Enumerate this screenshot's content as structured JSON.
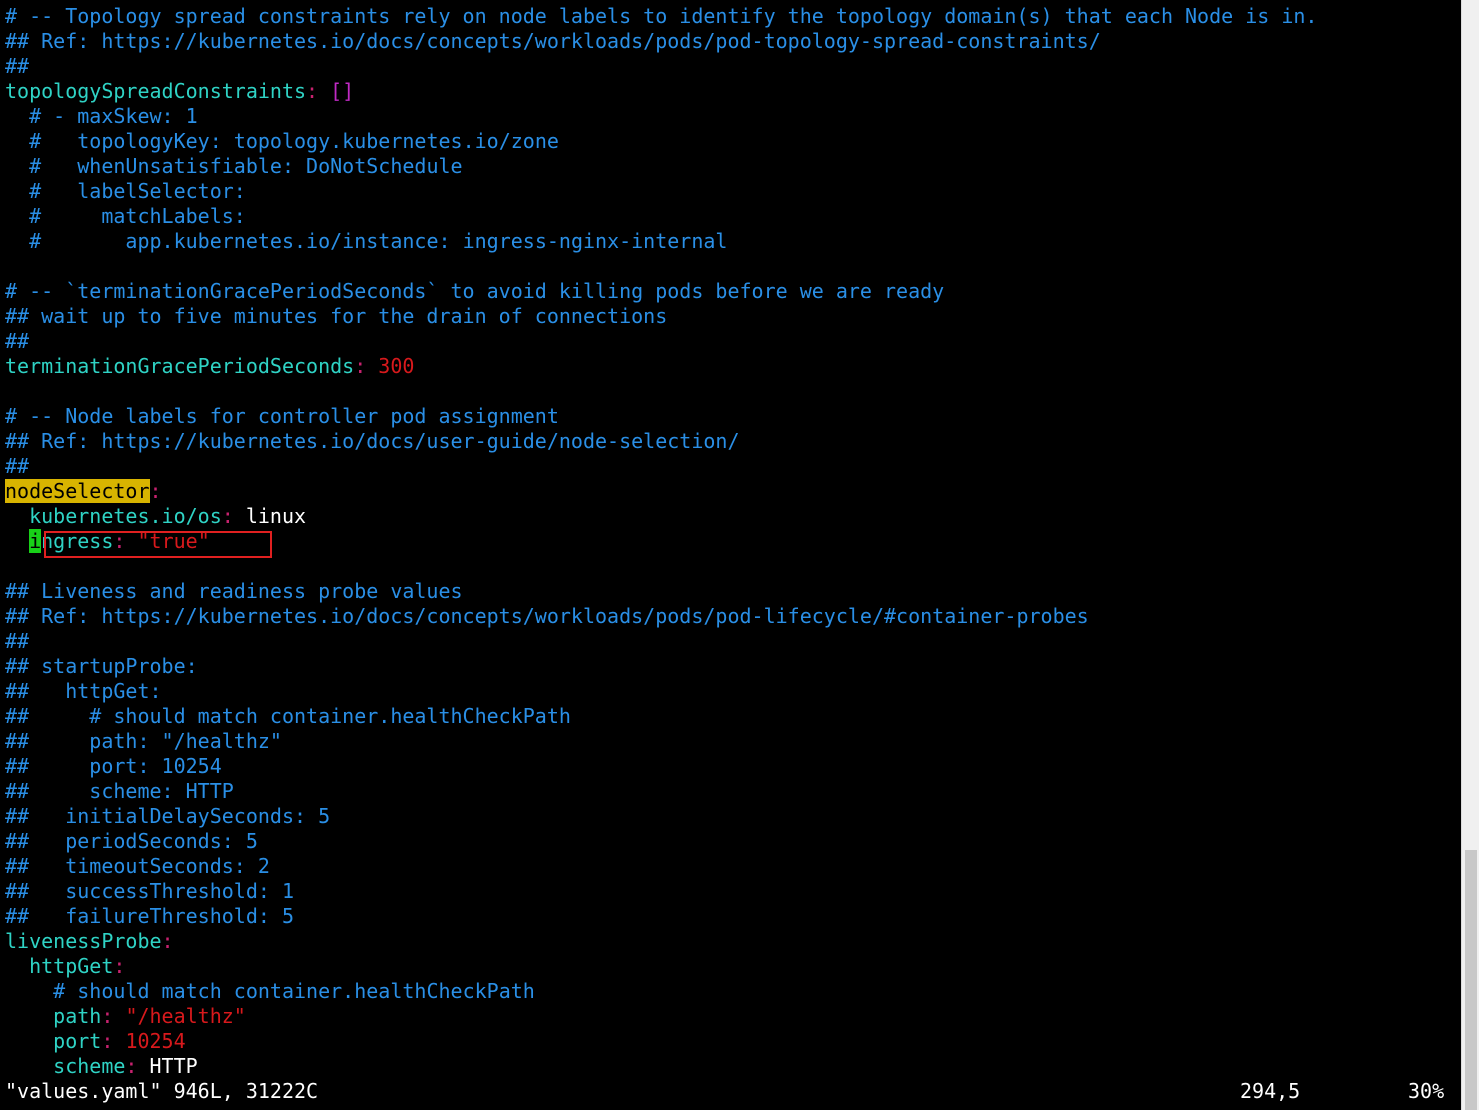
{
  "editor": {
    "lines": [
      [
        {
          "t": "comment",
          "v": "# -- Topology spread constraints rely on node labels to identify the topology domain(s) that each Node is in."
        }
      ],
      [
        {
          "t": "comment",
          "v": "## Ref: https://kubernetes.io/docs/concepts/workloads/pods/pod-topology-spread-constraints/"
        }
      ],
      [
        {
          "t": "comment",
          "v": "##"
        }
      ],
      [
        {
          "t": "key",
          "v": "topologySpreadConstraints"
        },
        {
          "t": "punct",
          "v": ":"
        },
        {
          "t": "plain",
          "v": " "
        },
        {
          "t": "bracket",
          "v": "[]"
        }
      ],
      [
        {
          "t": "plain",
          "v": "  "
        },
        {
          "t": "comment",
          "v": "# - maxSkew: 1"
        }
      ],
      [
        {
          "t": "plain",
          "v": "  "
        },
        {
          "t": "comment",
          "v": "#   topologyKey: topology.kubernetes.io/zone"
        }
      ],
      [
        {
          "t": "plain",
          "v": "  "
        },
        {
          "t": "comment",
          "v": "#   whenUnsatisfiable: DoNotSchedule"
        }
      ],
      [
        {
          "t": "plain",
          "v": "  "
        },
        {
          "t": "comment",
          "v": "#   labelSelector:"
        }
      ],
      [
        {
          "t": "plain",
          "v": "  "
        },
        {
          "t": "comment",
          "v": "#     matchLabels:"
        }
      ],
      [
        {
          "t": "plain",
          "v": "  "
        },
        {
          "t": "comment",
          "v": "#       app.kubernetes.io/instance: ingress-nginx-internal"
        }
      ],
      [],
      [
        {
          "t": "comment",
          "v": "# -- `terminationGracePeriodSeconds` to avoid killing pods before we are ready"
        }
      ],
      [
        {
          "t": "comment",
          "v": "## wait up to five minutes for the drain of connections"
        }
      ],
      [
        {
          "t": "comment",
          "v": "##"
        }
      ],
      [
        {
          "t": "key",
          "v": "terminationGracePeriodSeconds"
        },
        {
          "t": "punct",
          "v": ":"
        },
        {
          "t": "plain",
          "v": " "
        },
        {
          "t": "num",
          "v": "300"
        }
      ],
      [],
      [
        {
          "t": "comment",
          "v": "# -- Node labels for controller pod assignment"
        }
      ],
      [
        {
          "t": "comment",
          "v": "## Ref: https://kubernetes.io/docs/user-guide/node-selection/"
        }
      ],
      [
        {
          "t": "comment",
          "v": "##"
        }
      ],
      [
        {
          "t": "search",
          "v": "nodeSelector"
        },
        {
          "t": "punct",
          "v": ":"
        }
      ],
      [
        {
          "t": "plain",
          "v": "  "
        },
        {
          "t": "key",
          "v": "kubernetes.io/os"
        },
        {
          "t": "punct",
          "v": ":"
        },
        {
          "t": "plain",
          "v": " linux"
        }
      ],
      [
        {
          "t": "plain",
          "v": "  "
        },
        {
          "t": "cursor",
          "v": "i"
        },
        {
          "t": "key",
          "v": "ngress"
        },
        {
          "t": "punct",
          "v": ":"
        },
        {
          "t": "plain",
          "v": " "
        },
        {
          "t": "str",
          "v": "\"true\""
        }
      ],
      [],
      [
        {
          "t": "comment",
          "v": "## Liveness and readiness probe values"
        }
      ],
      [
        {
          "t": "comment",
          "v": "## Ref: https://kubernetes.io/docs/concepts/workloads/pods/pod-lifecycle/#container-probes"
        }
      ],
      [
        {
          "t": "comment",
          "v": "##"
        }
      ],
      [
        {
          "t": "comment",
          "v": "## startupProbe:"
        }
      ],
      [
        {
          "t": "comment",
          "v": "##   httpGet:"
        }
      ],
      [
        {
          "t": "comment",
          "v": "##     # should match container.healthCheckPath"
        }
      ],
      [
        {
          "t": "comment",
          "v": "##     path: \"/healthz\""
        }
      ],
      [
        {
          "t": "comment",
          "v": "##     port: 10254"
        }
      ],
      [
        {
          "t": "comment",
          "v": "##     scheme: HTTP"
        }
      ],
      [
        {
          "t": "comment",
          "v": "##   initialDelaySeconds: 5"
        }
      ],
      [
        {
          "t": "comment",
          "v": "##   periodSeconds: 5"
        }
      ],
      [
        {
          "t": "comment",
          "v": "##   timeoutSeconds: 2"
        }
      ],
      [
        {
          "t": "comment",
          "v": "##   successThreshold: 1"
        }
      ],
      [
        {
          "t": "comment",
          "v": "##   failureThreshold: 5"
        }
      ],
      [
        {
          "t": "key",
          "v": "livenessProbe"
        },
        {
          "t": "punct",
          "v": ":"
        }
      ],
      [
        {
          "t": "plain",
          "v": "  "
        },
        {
          "t": "key",
          "v": "httpGet"
        },
        {
          "t": "punct",
          "v": ":"
        }
      ],
      [
        {
          "t": "plain",
          "v": "    "
        },
        {
          "t": "comment",
          "v": "# should match container.healthCheckPath"
        }
      ],
      [
        {
          "t": "plain",
          "v": "    "
        },
        {
          "t": "key",
          "v": "path"
        },
        {
          "t": "punct",
          "v": ":"
        },
        {
          "t": "plain",
          "v": " "
        },
        {
          "t": "str",
          "v": "\"/healthz\""
        }
      ],
      [
        {
          "t": "plain",
          "v": "    "
        },
        {
          "t": "key",
          "v": "port"
        },
        {
          "t": "punct",
          "v": ":"
        },
        {
          "t": "plain",
          "v": " "
        },
        {
          "t": "num",
          "v": "10254"
        }
      ],
      [
        {
          "t": "plain",
          "v": "    "
        },
        {
          "t": "key",
          "v": "scheme"
        },
        {
          "t": "punct",
          "v": ":"
        },
        {
          "t": "plain",
          "v": " HTTP"
        }
      ]
    ]
  },
  "status": {
    "file": "\"values.yaml\" 946L, 31222C",
    "position": "294,5",
    "percent": "30%"
  },
  "scroll": {
    "fraction_start": 0.766,
    "fraction_visible": 0.234
  },
  "colors": {
    "background": "#000000",
    "comment": "#2a8fe6",
    "key": "#2fd3c5",
    "punct": "#c8226f",
    "number": "#d8191c",
    "search_highlight": "#d8b400",
    "cursor": "#18d018",
    "annotation_box": "#e02020"
  }
}
